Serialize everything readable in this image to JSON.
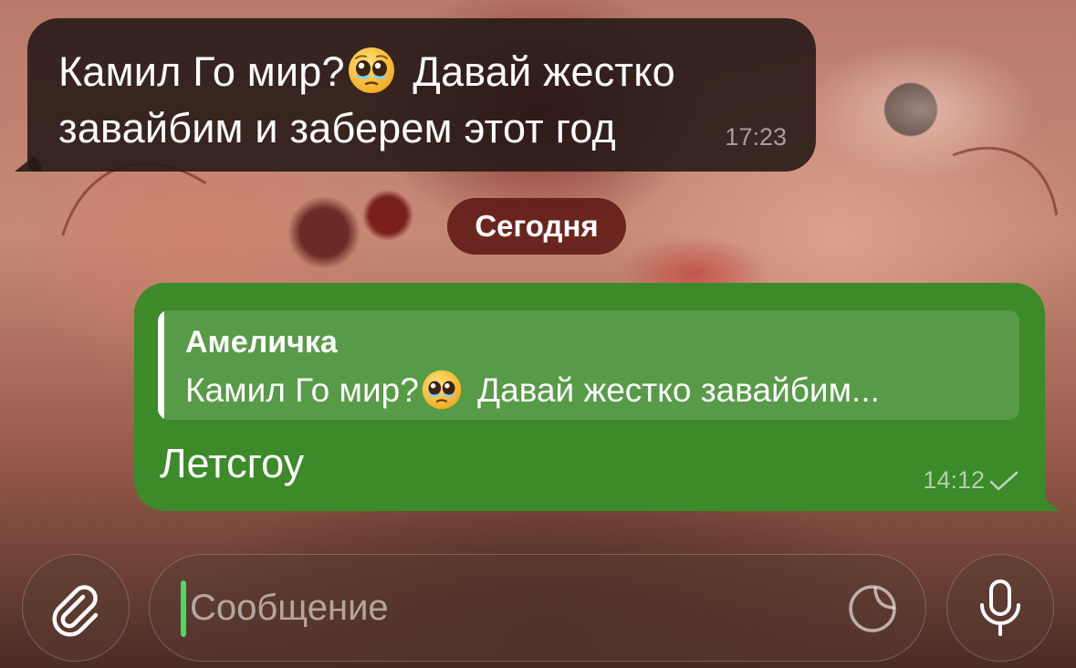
{
  "chat": {
    "incoming": {
      "text_part1": "Камил Го мир?",
      "emoji": "pleading-face",
      "text_part2": " Давай жестко завайбим и заберем этот год",
      "time": "17:23"
    },
    "date_separator": "Сегодня",
    "outgoing": {
      "reply_author": "Амеличка",
      "reply_text_part1": "Камил Го мир?",
      "reply_emoji": "pleading-face",
      "reply_text_part2": " Давай жестко завайбим...",
      "text": "Летсгоу",
      "time": "14:12",
      "status": "sent-single-check"
    }
  },
  "input_bar": {
    "placeholder": "Сообщение",
    "value": "",
    "attach_icon": "paperclip-icon",
    "sticker_icon": "sticker-icon",
    "mic_icon": "microphone-icon"
  },
  "colors": {
    "outgoing_bubble": "#3c8a2a",
    "incoming_bubble": "#241816",
    "date_pill": "#58100e",
    "caret": "#4cd964"
  }
}
